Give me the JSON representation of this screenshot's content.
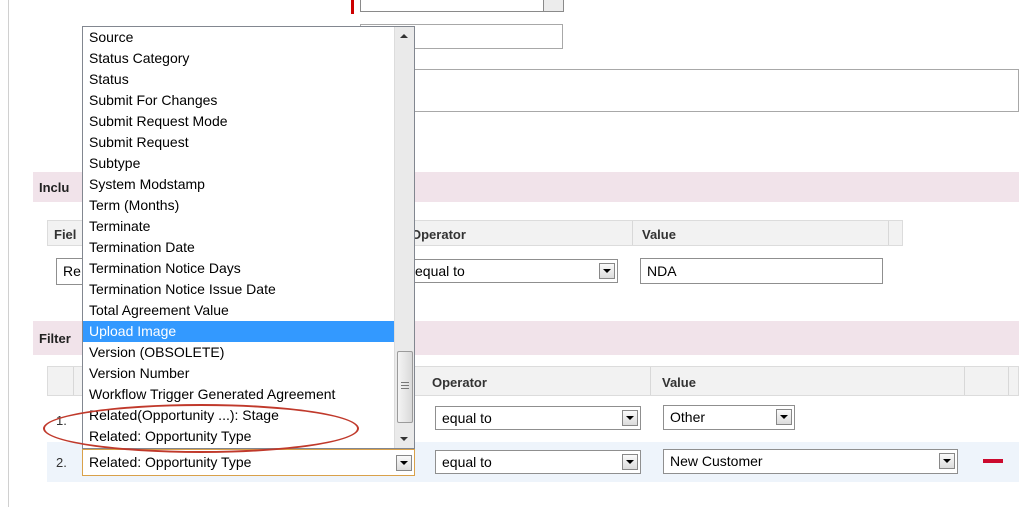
{
  "include_section": {
    "title_visible": "Inclu",
    "field_header_visible": "Fiel",
    "operator_header": "Operator",
    "value_header": "Value",
    "row": {
      "field_visible": "Re",
      "operator": "equal to",
      "value": "NDA"
    }
  },
  "filter_section": {
    "title_visible": "Filter",
    "operator_header": "Operator",
    "value_header": "Value",
    "rows": [
      {
        "num": "1.",
        "field": "Related(Opportunity ...): Stage",
        "operator": "equal to",
        "value": "Other"
      },
      {
        "num": "2.",
        "field": "Related: Opportunity Type",
        "operator": "equal to",
        "value": "New Customer"
      }
    ]
  },
  "dropdown": {
    "items": [
      "Source",
      "Status Category",
      "Status",
      "Submit For Changes",
      "Submit Request Mode",
      "Submit Request",
      "Subtype",
      "System Modstamp",
      "Term (Months)",
      "Terminate",
      "Termination Date",
      "Termination Notice Days",
      "Termination Notice Issue Date",
      "Total Agreement Value",
      "Upload Image",
      "Version (OBSOLETE)",
      "Version Number",
      "Workflow Trigger Generated Agreement",
      "Related(Opportunity ...): Stage",
      "Related: Opportunity Type"
    ],
    "highlighted_index": 14,
    "highlight_color": "#3399ff"
  },
  "colors": {
    "section_band": "#f1e3ea",
    "remove_icon": "#cc0a2e",
    "annotation_oval": "#c0392b"
  }
}
